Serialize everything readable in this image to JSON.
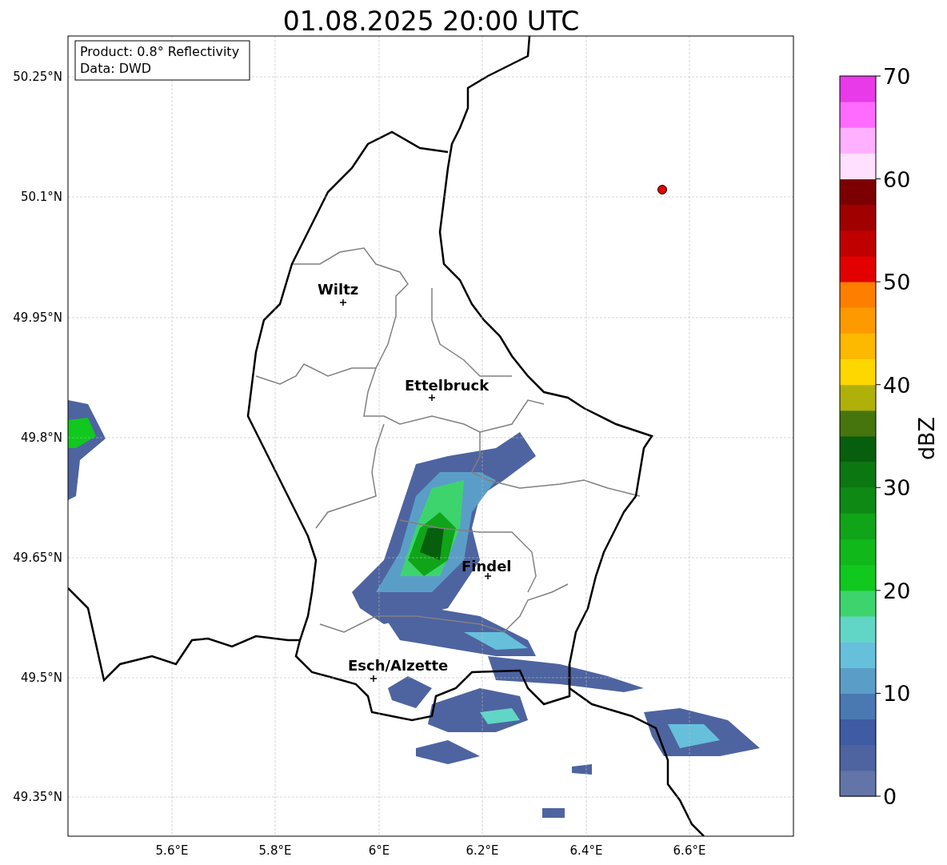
{
  "title": "01.08.2025 20:00 UTC",
  "info_box": {
    "lines": [
      "Product: 0.8° Reflectivity",
      "Data: DWD"
    ]
  },
  "map": {
    "yticks": [
      "50.25°N",
      "50.1°N",
      "49.95°N",
      "49.8°N",
      "49.65°N",
      "49.5°N",
      "49.35°N"
    ],
    "xticks": [
      "5.6°E",
      "5.8°E",
      "6°E",
      "6.2°E",
      "6.4°E",
      "6.6°E"
    ],
    "cities": [
      {
        "name": "Wiltz"
      },
      {
        "name": "Ettelbruck"
      },
      {
        "name": "Findel"
      },
      {
        "name": "Esch/Alzette"
      }
    ]
  },
  "colorbar": {
    "label": "dBZ",
    "ticks": [
      "70",
      "60",
      "50",
      "40",
      "30",
      "20",
      "10",
      "0"
    ],
    "segments": [
      {
        "color": "#6374a8"
      },
      {
        "color": "#4e64a0"
      },
      {
        "color": "#3f5ba3"
      },
      {
        "color": "#4a78b1"
      },
      {
        "color": "#5a9ec8"
      },
      {
        "color": "#66c0dc"
      },
      {
        "color": "#62d6c6"
      },
      {
        "color": "#3dd46e"
      },
      {
        "color": "#10c81e"
      },
      {
        "color": "#10b81a"
      },
      {
        "color": "#10a418"
      },
      {
        "color": "#0e8a14"
      },
      {
        "color": "#0b7710"
      },
      {
        "color": "#075f0e"
      },
      {
        "color": "#47750d"
      },
      {
        "color": "#b0b00a"
      },
      {
        "color": "#fed700"
      },
      {
        "color": "#fdb800"
      },
      {
        "color": "#fe9a00"
      },
      {
        "color": "#fe7f00"
      },
      {
        "color": "#e20000"
      },
      {
        "color": "#c00000"
      },
      {
        "color": "#a00000"
      },
      {
        "color": "#7d0000"
      },
      {
        "color": "#ffe0ff"
      },
      {
        "color": "#ffb0ff"
      },
      {
        "color": "#ff6bff"
      },
      {
        "color": "#e83ae8"
      }
    ]
  }
}
